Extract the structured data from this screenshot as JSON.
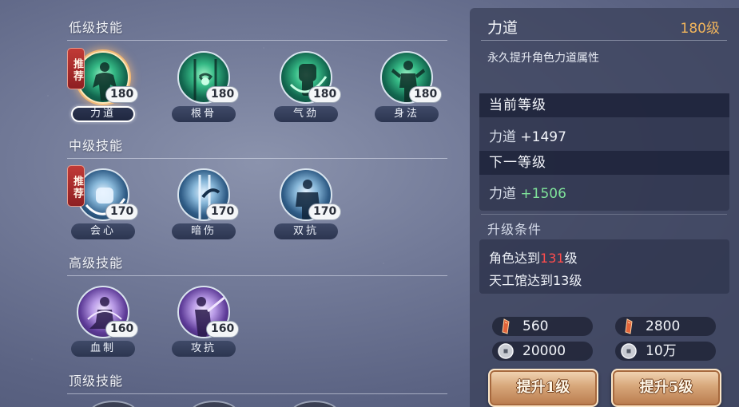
{
  "sections": {
    "low": "低级技能",
    "mid": "中级技能",
    "high": "高级技能",
    "top": "顶级技能"
  },
  "recommend_badge": "推荐",
  "skills": {
    "low": [
      {
        "name": "力道",
        "level": "180",
        "icon": "strength-icon",
        "recommended": true,
        "selected": true
      },
      {
        "name": "根骨",
        "level": "180",
        "icon": "constitution-icon"
      },
      {
        "name": "气劲",
        "level": "180",
        "icon": "fist-icon"
      },
      {
        "name": "身法",
        "level": "180",
        "icon": "agility-icon"
      }
    ],
    "mid": [
      {
        "name": "会心",
        "level": "170",
        "icon": "critical-fist-icon",
        "recommended": true
      },
      {
        "name": "暗伤",
        "level": "170",
        "icon": "hidden-wound-icon"
      },
      {
        "name": "双抗",
        "level": "170",
        "icon": "dual-resist-icon"
      }
    ],
    "high": [
      {
        "name": "血制",
        "level": "160",
        "icon": "meditation-icon"
      },
      {
        "name": "攻抗",
        "level": "160",
        "icon": "sword-stance-icon"
      }
    ]
  },
  "detail": {
    "title": "力道",
    "level": "180级",
    "description": "永久提升角色力道属性",
    "current_header": "当前等级",
    "current_stat": "力道",
    "current_value": "+1497",
    "next_header": "下一等级",
    "next_stat": "力道",
    "next_value": "+1506",
    "cond_title": "升级条件",
    "cond1_prefix": "角色达到",
    "cond1_value": "131",
    "cond1_suffix": "级",
    "cond2": "天工馆达到13级"
  },
  "costs": {
    "one": {
      "material": "560",
      "coins": "20000"
    },
    "five": {
      "material": "2800",
      "coins": "10万"
    }
  },
  "buttons": {
    "upgrade1": "提升1级",
    "upgrade5": "提升5级"
  },
  "colors": {
    "accent_gold": "#f0b45c",
    "green_value": "#7fe39a",
    "red_requirement": "#ff4d4d"
  }
}
